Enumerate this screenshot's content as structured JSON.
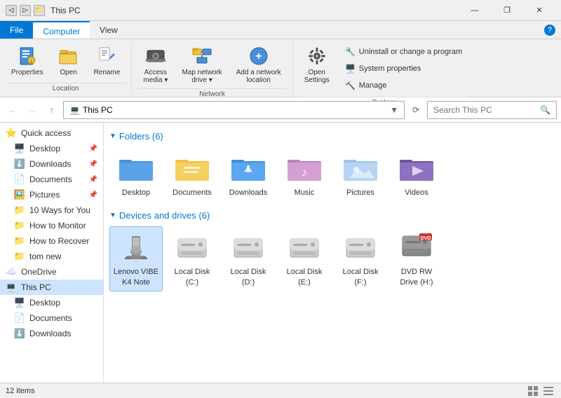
{
  "titleBar": {
    "title": "This PC",
    "icons": [
      "▢",
      "❐",
      "🔲"
    ],
    "winBtns": [
      "—",
      "❐",
      "✕"
    ]
  },
  "ribbon": {
    "tabs": [
      "File",
      "Computer",
      "View"
    ],
    "activeTab": "Computer",
    "groups": [
      {
        "label": "Location",
        "items": [
          {
            "type": "big",
            "icon": "📋",
            "label": "Properties"
          },
          {
            "type": "big",
            "icon": "📂",
            "label": "Open"
          },
          {
            "type": "big",
            "icon": "✏️",
            "label": "Rename"
          }
        ]
      },
      {
        "label": "Network",
        "items": [
          {
            "type": "big",
            "icon": "💾",
            "label": "Access\nmedia ▾"
          },
          {
            "type": "big",
            "icon": "🌐",
            "label": "Map network\ndrive ▾"
          },
          {
            "type": "big",
            "icon": "➕",
            "label": "Add a network\nlocation"
          }
        ]
      },
      {
        "label": "System",
        "items": [
          {
            "type": "big",
            "icon": "⚙️",
            "label": "Open\nSettings"
          },
          {
            "type": "small-list",
            "items": [
              {
                "icon": "🔧",
                "label": "Uninstall or change a program"
              },
              {
                "icon": "🖥️",
                "label": "System properties"
              },
              {
                "icon": "🔨",
                "label": "Manage"
              }
            ]
          }
        ]
      }
    ]
  },
  "addressBar": {
    "backDisabled": true,
    "forwardDisabled": true,
    "upEnabled": true,
    "path": "This PC",
    "pathIcon": "💻",
    "searchPlaceholder": "Search This PC"
  },
  "sidebar": {
    "quickAccessLabel": "Quick access",
    "items": [
      {
        "icon": "🌟",
        "label": "Quick access",
        "type": "section",
        "pinned": false
      },
      {
        "icon": "🖥️",
        "label": "Desktop",
        "type": "item",
        "pinned": true
      },
      {
        "icon": "⬇️",
        "label": "Downloads",
        "type": "item",
        "pinned": true
      },
      {
        "icon": "📄",
        "label": "Documents",
        "type": "item",
        "pinned": true
      },
      {
        "icon": "🖼️",
        "label": "Pictures",
        "type": "item",
        "pinned": true
      },
      {
        "icon": "📁",
        "label": "10 Ways for You",
        "type": "item",
        "pinned": false
      },
      {
        "icon": "📁",
        "label": "How to Monitor",
        "type": "item",
        "pinned": false
      },
      {
        "icon": "📁",
        "label": "How to Recover",
        "type": "item",
        "pinned": false
      },
      {
        "icon": "📁",
        "label": "tom new",
        "type": "item",
        "pinned": false
      },
      {
        "icon": "☁️",
        "label": "OneDrive",
        "type": "section",
        "pinned": false
      },
      {
        "icon": "💻",
        "label": "This PC",
        "type": "item",
        "selected": true
      },
      {
        "icon": "🖥️",
        "label": "Desktop",
        "type": "item"
      },
      {
        "icon": "📄",
        "label": "Documents",
        "type": "item"
      },
      {
        "icon": "⬇️",
        "label": "Downloads",
        "type": "item"
      }
    ]
  },
  "fileArea": {
    "sections": [
      {
        "title": "Folders (6)",
        "items": [
          {
            "name": "Desktop",
            "type": "folder",
            "color": "#4a90d9"
          },
          {
            "name": "Documents",
            "type": "folder",
            "color": "#f0c040"
          },
          {
            "name": "Downloads",
            "type": "folder",
            "color": "#3a8fdd"
          },
          {
            "name": "Music",
            "type": "folder",
            "color": "#d4a0d0"
          },
          {
            "name": "Pictures",
            "type": "folder",
            "color": "#a0c4e8"
          },
          {
            "name": "Videos",
            "type": "folder",
            "color": "#8060b0"
          }
        ]
      },
      {
        "title": "Devices and drives (6)",
        "items": [
          {
            "name": "Lenovo VIBE K4 Note",
            "type": "phone",
            "selected": true
          },
          {
            "name": "Local Disk (C:)",
            "type": "drive"
          },
          {
            "name": "Local Disk (D:)",
            "type": "drive"
          },
          {
            "name": "Local Disk (E:)",
            "type": "drive"
          },
          {
            "name": "Local Disk (F:)",
            "type": "drive"
          },
          {
            "name": "DVD RW Drive (H:)",
            "type": "dvd"
          }
        ]
      }
    ]
  },
  "statusBar": {
    "count": "12 items"
  }
}
